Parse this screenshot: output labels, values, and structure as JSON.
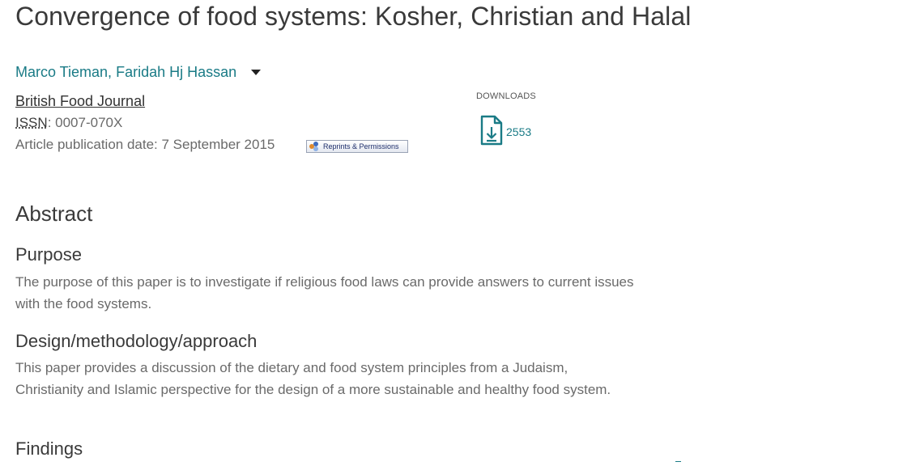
{
  "article": {
    "title": "Convergence of food systems: Kosher, Christian and Halal",
    "authors": [
      "Marco Tieman",
      "Faridah Hj Hassan"
    ],
    "author_separator": ",",
    "authors_toggle_icon": "caret-down-icon",
    "journal": "British Food Journal",
    "issn_label": "ISSN",
    "issn_value": ": 0007-070X",
    "pub_date": "Article publication date: 7 September 2015",
    "reprints_label": "Reprints & Permissions"
  },
  "downloads": {
    "label": "DOWNLOADS",
    "count": "2553",
    "icon": "file-download-icon"
  },
  "abstract": {
    "heading": "Abstract",
    "sections": [
      {
        "heading": "Purpose",
        "text": "The purpose of this paper is to investigate if religious food laws can provide answers to current issues with the food systems."
      },
      {
        "heading": "Design/methodology/approach",
        "text": "This paper provides a discussion of the dietary and food system principles from a Judaism, Christianity and Islamic perspective for the design of a more sustainable and healthy food system."
      },
      {
        "heading": "Findings",
        "text": ""
      }
    ]
  },
  "colors": {
    "link_teal": "#1a7b86",
    "heading": "#3a3a3a",
    "body_text": "#6a6a6a"
  }
}
